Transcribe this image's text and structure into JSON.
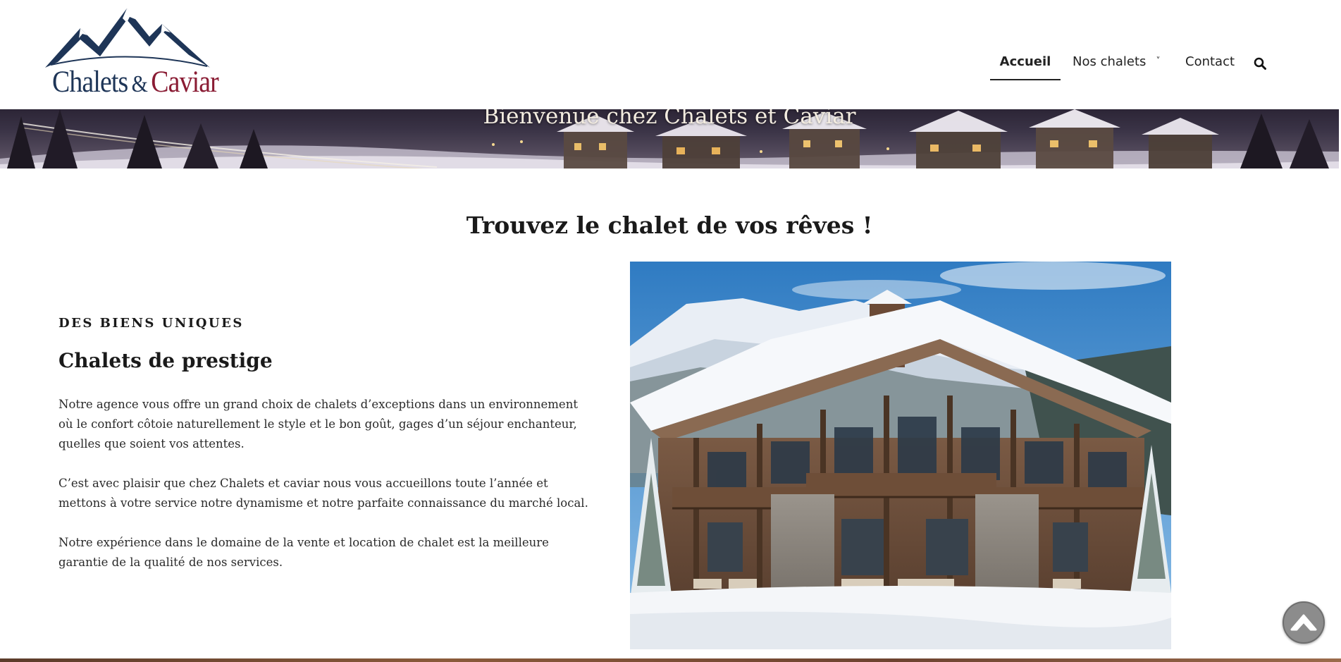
{
  "brand": {
    "name_part1": "Chalets",
    "ampersand": "&",
    "name_part2": "Caviar",
    "colors": {
      "navy": "#1e3557",
      "burgundy": "#8a1c34"
    }
  },
  "nav": {
    "items": [
      {
        "label": "Accueil",
        "active": true
      },
      {
        "label": "Nos chalets",
        "has_dropdown": true,
        "chevron": "˅"
      },
      {
        "label": "Contact"
      }
    ],
    "search_icon": "search-icon"
  },
  "banner": {
    "title": "Bienvenue chez Chalets et Caviar"
  },
  "main": {
    "title": "Trouvez le chalet de vos rêves !"
  },
  "feature": {
    "eyebrow": "DES BIENS UNIQUES",
    "title": "Chalets de prestige",
    "paragraphs": [
      "Notre agence vous offre un grand choix de chalets d’exceptions dans un environnement où le confort côtoie naturellement le style et le bon goût, gages d’un séjour enchanteur, quelles que soient vos attentes.",
      "C’est avec plaisir que chez Chalets et caviar nous vous accueillons toute l’année et mettons à votre service notre dynamisme et notre parfaite connaissance du marché local.",
      "Notre expérience dans le domaine de la vente et location de chalet est la meilleure garantie de la qualité de nos services."
    ]
  },
  "scroll_top": {
    "icon": "chevron-up-icon"
  }
}
